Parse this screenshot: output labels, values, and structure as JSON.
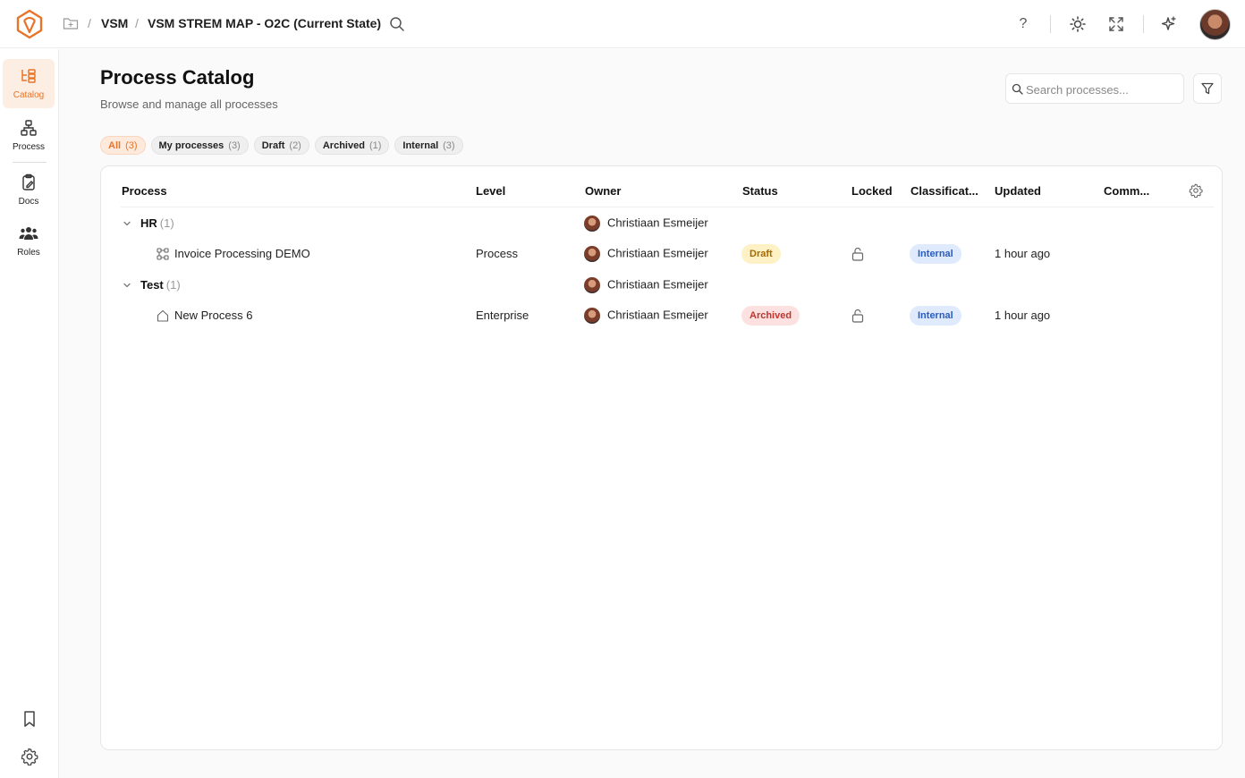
{
  "breadcrumb": {
    "root": "VSM",
    "current": "VSM STREM MAP - O2C (Current State)"
  },
  "top_icons": [
    "folder-icon",
    "search-icon",
    "help-icon",
    "sun-icon",
    "expand-icon",
    "sparkle-icon",
    "user-avatar"
  ],
  "help_label": "?",
  "sidebar": {
    "items": [
      {
        "label": "Catalog",
        "icon": "catalog-icon",
        "active": true
      },
      {
        "label": "Process",
        "icon": "process-icon",
        "active": false
      },
      {
        "label": "Docs",
        "icon": "docs-icon",
        "active": false
      },
      {
        "label": "Roles",
        "icon": "roles-icon",
        "active": false
      }
    ],
    "bottom": [
      "bookmark-icon",
      "settings-icon"
    ]
  },
  "page": {
    "title": "Process Catalog",
    "subtitle": "Browse and manage all processes"
  },
  "search": {
    "placeholder": "Search processes..."
  },
  "filters": [
    {
      "label": "All",
      "count": "(3)",
      "active": true
    },
    {
      "label": "My processes",
      "count": "(3)",
      "active": false
    },
    {
      "label": "Draft",
      "count": "(2)",
      "active": false
    },
    {
      "label": "Archived",
      "count": "(1)",
      "active": false
    },
    {
      "label": "Internal",
      "count": "(3)",
      "active": false
    }
  ],
  "table": {
    "columns": [
      "Process",
      "Level",
      "Owner",
      "Status",
      "Locked",
      "Classificat...",
      "Updated",
      "Comm..."
    ],
    "rows": [
      {
        "type": "group",
        "name": "HR",
        "count": "(1)",
        "owner": "Christiaan Esmeijer"
      },
      {
        "type": "item",
        "name": "Invoice Processing DEMO",
        "icon": "process-flow-icon",
        "level": "Process",
        "owner": "Christiaan Esmeijer",
        "status": "Draft",
        "locked": "unlocked",
        "classification": "Internal",
        "updated": "1 hour ago"
      },
      {
        "type": "group",
        "name": "Test",
        "count": "(1)",
        "owner": "Christiaan Esmeijer"
      },
      {
        "type": "item",
        "name": "New Process 6",
        "icon": "home-icon",
        "level": "Enterprise",
        "owner": "Christiaan Esmeijer",
        "status": "Archived",
        "locked": "unlocked",
        "classification": "Internal",
        "updated": "1 hour ago"
      }
    ]
  },
  "colors": {
    "accent": "#e8742a",
    "draft": "#a66a00",
    "archived": "#c0362c",
    "internal": "#2a5cbf"
  }
}
